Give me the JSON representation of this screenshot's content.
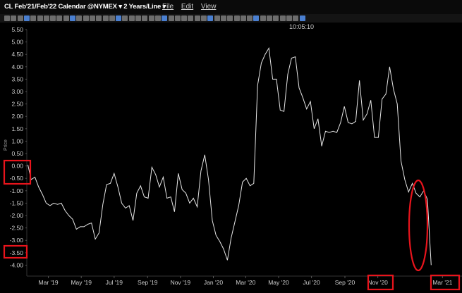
{
  "window": {
    "title": "CL Feb'21/Feb'22 Calendar @NYMEX ▾ 2 Years/Line ▾",
    "menu": [
      "File",
      "Edit",
      "View"
    ],
    "clock": "10:05:10"
  },
  "colors": {
    "background": "#000000",
    "line": "#e6e6e6",
    "highlight": "#e8141c",
    "axis_text": "#d0d0d0"
  },
  "chart_data": {
    "type": "line",
    "ylabel": "Price",
    "ylim": [
      -4.3,
      5.5
    ],
    "yticks": [
      "5.50",
      "5.00",
      "4.50",
      "4.00",
      "3.50",
      "3.00",
      "2.50",
      "2.00",
      "1.50",
      "1.00",
      "0.50",
      "0.00",
      "-0.50",
      "-1.00",
      "-1.50",
      "-2.00",
      "-2.50",
      "-3.00",
      "-3.50",
      "-4.00"
    ],
    "xlim": [
      "2019-01-20",
      "2021-03-28"
    ],
    "xticks": [
      {
        "date": "2019-03-01",
        "label": "Mar '19"
      },
      {
        "date": "2019-05-01",
        "label": "May '19"
      },
      {
        "date": "2019-07-01",
        "label": "Jul '19"
      },
      {
        "date": "2019-09-01",
        "label": "Sep '19"
      },
      {
        "date": "2019-11-01",
        "label": "Nov '19"
      },
      {
        "date": "2020-01-01",
        "label": "Jan '20"
      },
      {
        "date": "2020-03-01",
        "label": "Mar '20"
      },
      {
        "date": "2020-05-01",
        "label": "May '20"
      },
      {
        "date": "2020-07-01",
        "label": "Jul '20"
      },
      {
        "date": "2020-09-01",
        "label": "Sep '20"
      },
      {
        "date": "2020-11-01",
        "label": "Nov '20"
      },
      {
        "date": "2021-03-01",
        "label": "Mar '21"
      }
    ],
    "series": [
      {
        "points": [
          [
            "2019-01-22",
            0.05
          ],
          [
            "2019-01-28",
            -0.55
          ],
          [
            "2019-02-04",
            -0.45
          ],
          [
            "2019-02-11",
            -0.85
          ],
          [
            "2019-02-18",
            -1.15
          ],
          [
            "2019-02-25",
            -1.5
          ],
          [
            "2019-03-04",
            -1.6
          ],
          [
            "2019-03-11",
            -1.5
          ],
          [
            "2019-03-18",
            -1.55
          ],
          [
            "2019-03-25",
            -1.5
          ],
          [
            "2019-04-01",
            -1.8
          ],
          [
            "2019-04-08",
            -2.0
          ],
          [
            "2019-04-15",
            -2.15
          ],
          [
            "2019-04-22",
            -2.55
          ],
          [
            "2019-04-29",
            -2.45
          ],
          [
            "2019-05-06",
            -2.45
          ],
          [
            "2019-05-13",
            -2.35
          ],
          [
            "2019-05-20",
            -2.3
          ],
          [
            "2019-05-27",
            -2.95
          ],
          [
            "2019-06-03",
            -2.7
          ],
          [
            "2019-06-10",
            -1.55
          ],
          [
            "2019-06-17",
            -0.75
          ],
          [
            "2019-06-24",
            -0.7
          ],
          [
            "2019-07-01",
            -0.3
          ],
          [
            "2019-07-08",
            -0.85
          ],
          [
            "2019-07-15",
            -1.5
          ],
          [
            "2019-07-22",
            -1.7
          ],
          [
            "2019-07-29",
            -1.6
          ],
          [
            "2019-08-05",
            -2.2
          ],
          [
            "2019-08-12",
            -1.1
          ],
          [
            "2019-08-19",
            -0.8
          ],
          [
            "2019-08-26",
            -1.25
          ],
          [
            "2019-09-02",
            -1.3
          ],
          [
            "2019-09-09",
            -0.05
          ],
          [
            "2019-09-16",
            -0.35
          ],
          [
            "2019-09-23",
            -0.85
          ],
          [
            "2019-09-30",
            -0.45
          ],
          [
            "2019-10-07",
            -1.3
          ],
          [
            "2019-10-14",
            -1.25
          ],
          [
            "2019-10-21",
            -1.85
          ],
          [
            "2019-10-28",
            -0.3
          ],
          [
            "2019-11-04",
            -0.95
          ],
          [
            "2019-11-11",
            -1.1
          ],
          [
            "2019-11-18",
            -1.5
          ],
          [
            "2019-11-25",
            -1.3
          ],
          [
            "2019-12-02",
            -1.65
          ],
          [
            "2019-12-09",
            -0.2
          ],
          [
            "2019-12-16",
            0.45
          ],
          [
            "2019-12-23",
            -0.55
          ],
          [
            "2019-12-30",
            -2.2
          ],
          [
            "2020-01-06",
            -2.8
          ],
          [
            "2020-01-13",
            -3.05
          ],
          [
            "2020-01-20",
            -3.35
          ],
          [
            "2020-01-27",
            -3.8
          ],
          [
            "2020-02-03",
            -2.9
          ],
          [
            "2020-02-10",
            -2.25
          ],
          [
            "2020-02-17",
            -1.6
          ],
          [
            "2020-02-24",
            -0.65
          ],
          [
            "2020-03-02",
            -0.5
          ],
          [
            "2020-03-09",
            -0.8
          ],
          [
            "2020-03-16",
            -0.7
          ],
          [
            "2020-03-23",
            3.25
          ],
          [
            "2020-03-30",
            4.15
          ],
          [
            "2020-04-06",
            4.5
          ],
          [
            "2020-04-13",
            4.75
          ],
          [
            "2020-04-20",
            3.5
          ],
          [
            "2020-04-27",
            3.5
          ],
          [
            "2020-05-04",
            2.25
          ],
          [
            "2020-05-11",
            2.2
          ],
          [
            "2020-05-18",
            3.7
          ],
          [
            "2020-05-25",
            4.35
          ],
          [
            "2020-06-01",
            4.4
          ],
          [
            "2020-06-08",
            3.15
          ],
          [
            "2020-06-15",
            2.75
          ],
          [
            "2020-06-22",
            2.3
          ],
          [
            "2020-06-29",
            2.6
          ],
          [
            "2020-07-06",
            1.5
          ],
          [
            "2020-07-13",
            1.9
          ],
          [
            "2020-07-20",
            0.8
          ],
          [
            "2020-07-27",
            1.4
          ],
          [
            "2020-08-03",
            1.35
          ],
          [
            "2020-08-10",
            1.4
          ],
          [
            "2020-08-17",
            1.35
          ],
          [
            "2020-08-24",
            1.75
          ],
          [
            "2020-08-31",
            2.4
          ],
          [
            "2020-09-07",
            1.75
          ],
          [
            "2020-09-14",
            1.7
          ],
          [
            "2020-09-21",
            1.8
          ],
          [
            "2020-09-28",
            3.45
          ],
          [
            "2020-10-05",
            1.85
          ],
          [
            "2020-10-12",
            2.1
          ],
          [
            "2020-10-19",
            2.65
          ],
          [
            "2020-10-26",
            1.15
          ],
          [
            "2020-11-02",
            1.15
          ],
          [
            "2020-11-09",
            2.7
          ],
          [
            "2020-11-16",
            2.9
          ],
          [
            "2020-11-23",
            4.0
          ],
          [
            "2020-11-30",
            3.1
          ],
          [
            "2020-12-07",
            2.5
          ],
          [
            "2020-12-14",
            0.2
          ],
          [
            "2020-12-21",
            -0.55
          ],
          [
            "2020-12-28",
            -1.05
          ],
          [
            "2021-01-04",
            -0.7
          ],
          [
            "2021-01-11",
            -1.1
          ],
          [
            "2021-01-18",
            -1.25
          ],
          [
            "2021-01-25",
            -1.0
          ],
          [
            "2021-02-01",
            -1.35
          ],
          [
            "2021-02-08",
            -4.0
          ]
        ]
      }
    ]
  }
}
